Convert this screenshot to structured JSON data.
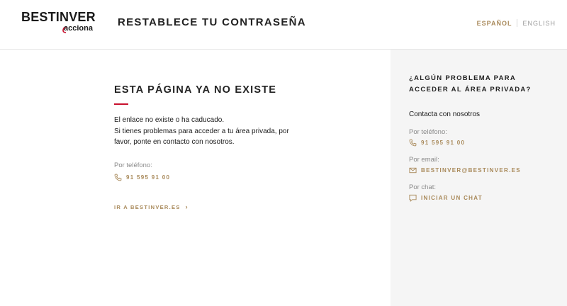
{
  "header": {
    "logo_main": "BESTINVER",
    "logo_sub": "acciona",
    "title": "RESTABLECE TU CONTRASEÑA",
    "lang_active": "ESPAÑOL",
    "lang_other": "ENGLISH"
  },
  "main": {
    "heading": "ESTA PÁGINA YA NO EXISTE",
    "message_line1": "El enlace no existe o ha caducado.",
    "message_line2": "Si tienes problemas para acceder a tu área privada, por favor, ponte en contacto con nosotros.",
    "phone_label": "Por teléfono:",
    "phone_value": "91 595 91 00",
    "back_link": "IR A BESTINVER.ES",
    "back_chevron": "›"
  },
  "aside": {
    "heading": "¿ALGÚN PROBLEMA PARA ACCEDER AL ÁREA PRIVADA?",
    "subheading": "Contacta con nosotros",
    "phone_label": "Por teléfono:",
    "phone_value": "91 595 91 00",
    "email_label": "Por email:",
    "email_value": "BESTINVER@BESTINVER.ES",
    "chat_label": "Por chat:",
    "chat_value": "INICIAR UN CHAT"
  },
  "colors": {
    "accent": "#a98a5b",
    "rule": "#c8102e",
    "aside_bg": "#f5f5f5"
  },
  "icons": {
    "phone": "phone-icon",
    "email": "envelope-icon",
    "chat": "chat-icon",
    "logo_mark": "acciona-mark-icon",
    "chevron": "chevron-right-icon"
  }
}
